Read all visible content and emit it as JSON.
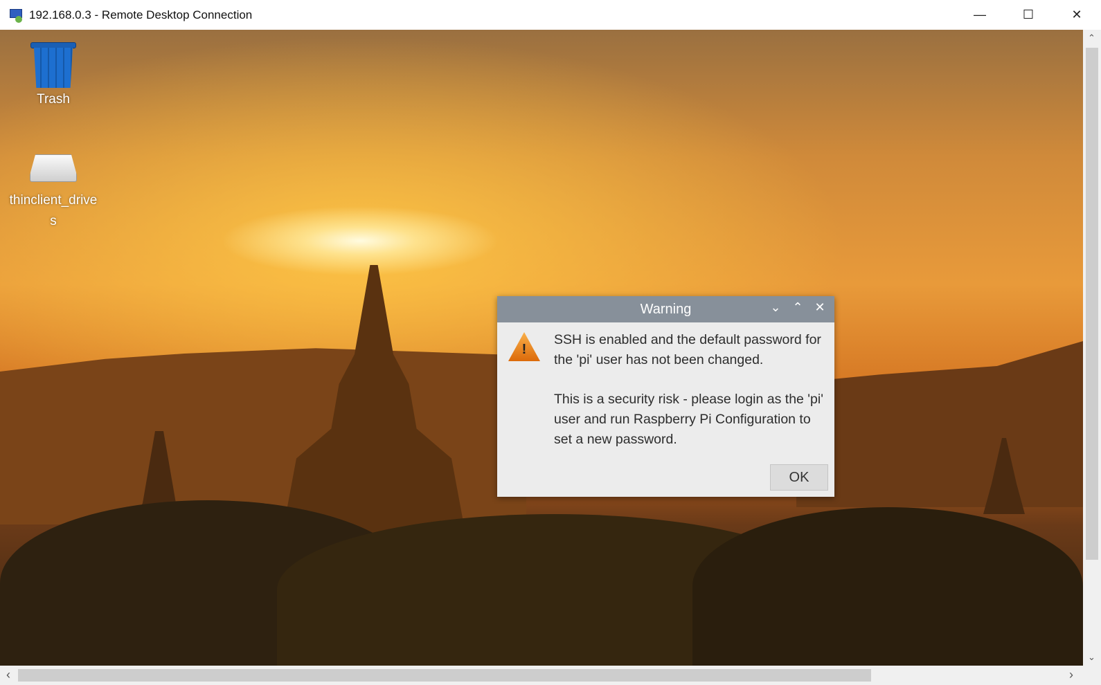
{
  "window": {
    "title": "192.168.0.3 - Remote Desktop Connection",
    "minimize": "—",
    "maximize": "☐",
    "close": "✕"
  },
  "desktop": {
    "icons": [
      {
        "label": "Trash"
      },
      {
        "label": "thinclient_drives"
      }
    ]
  },
  "dialog": {
    "title": "Warning",
    "paragraph1": "SSH is enabled and the default password for the 'pi' user has not been changed.",
    "paragraph2": "This is a security risk - please login as the 'pi' user and run Raspberry Pi Configuration to set a new password.",
    "ok_label": "OK",
    "collapse": "⌄",
    "expand": "⌃",
    "close": "✕"
  },
  "scrollbars": {
    "up": "⌃",
    "down": "⌄",
    "left": "‹",
    "right": "›"
  }
}
